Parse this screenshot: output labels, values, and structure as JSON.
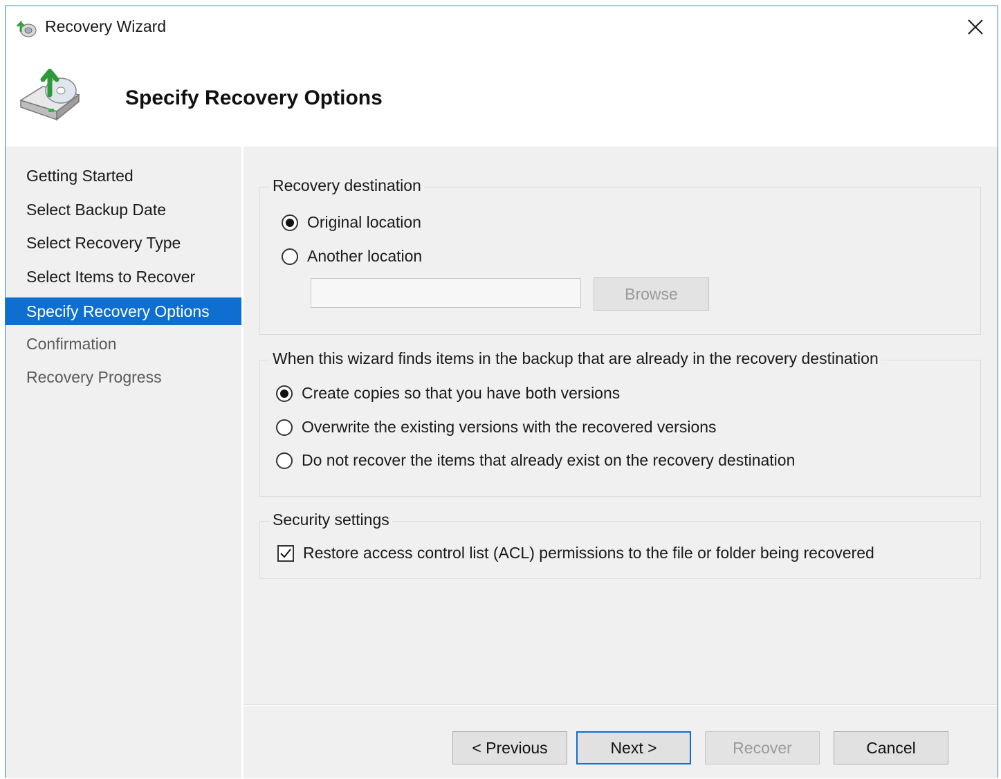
{
  "window": {
    "title": "Recovery Wizard",
    "close_icon": "close-icon",
    "header_title": "Specify Recovery Options"
  },
  "nav": {
    "items": [
      {
        "label": "Getting Started",
        "state": "normal"
      },
      {
        "label": "Select Backup Date",
        "state": "normal"
      },
      {
        "label": "Select Recovery Type",
        "state": "normal"
      },
      {
        "label": "Select Items to Recover",
        "state": "normal"
      },
      {
        "label": "Specify Recovery Options",
        "state": "active"
      },
      {
        "label": "Confirmation",
        "state": "disabled"
      },
      {
        "label": "Recovery Progress",
        "state": "disabled"
      }
    ]
  },
  "destination": {
    "legend": "Recovery destination",
    "original_label": "Original location",
    "another_label": "Another location",
    "selected": "original",
    "path_value": "",
    "browse_label": "Browse"
  },
  "conflict": {
    "legend": "When this wizard finds items in the backup that are already in the recovery destination",
    "options": [
      {
        "label": "Create copies so that you have both versions",
        "checked": true
      },
      {
        "label": "Overwrite the existing versions with the recovered versions",
        "checked": false
      },
      {
        "label": "Do not recover the items that already exist on the recovery destination",
        "checked": false
      }
    ]
  },
  "security": {
    "legend": "Security settings",
    "acl_label": "Restore access control list (ACL) permissions to the file or folder being recovered",
    "acl_checked": true
  },
  "buttons": {
    "previous": "< Previous",
    "next": "Next >",
    "recover": "Recover",
    "cancel": "Cancel"
  },
  "colors": {
    "accent": "#0e6fd1",
    "panel": "#f0f0f0",
    "window_border": "#3c7fb1"
  }
}
